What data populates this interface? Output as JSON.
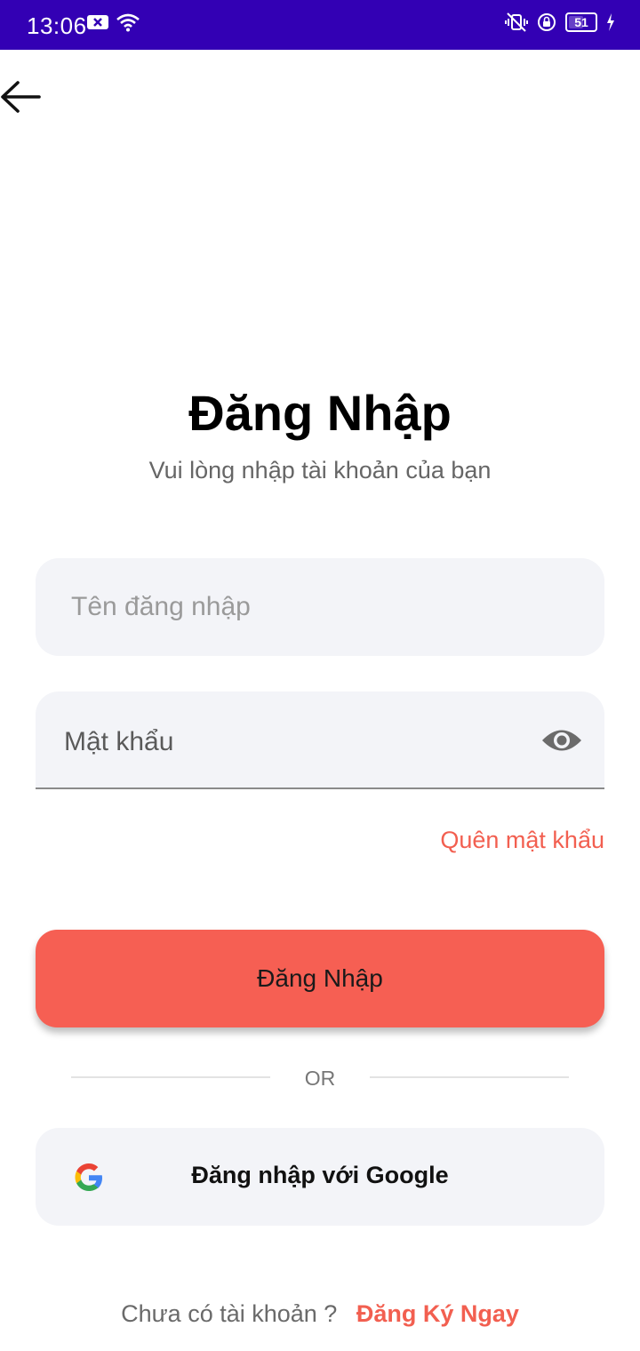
{
  "status_bar": {
    "time": "13:06",
    "battery_level": "51",
    "background_color": "#3300b4"
  },
  "header": {
    "back_icon": "arrow-left-icon"
  },
  "login": {
    "title": "Đăng Nhập",
    "subtitle": "Vui lòng nhập tài khoản của bạn",
    "username_placeholder": "Tên đăng nhập",
    "password_label": "Mật khẩu",
    "password_toggle_icon": "eye-icon",
    "forgot_password": "Quên mật khẩu",
    "submit_label": "Đăng Nhập",
    "divider_text": "OR",
    "google_label": "Đăng nhập với Google",
    "google_icon": "google-icon",
    "signup_prompt": "Chưa có tài khoản ?",
    "signup_link": "Đăng Ký Ngay"
  },
  "colors": {
    "accent": "#f65f53",
    "link": "#f25f50",
    "field_background": "#f3f4f8"
  }
}
